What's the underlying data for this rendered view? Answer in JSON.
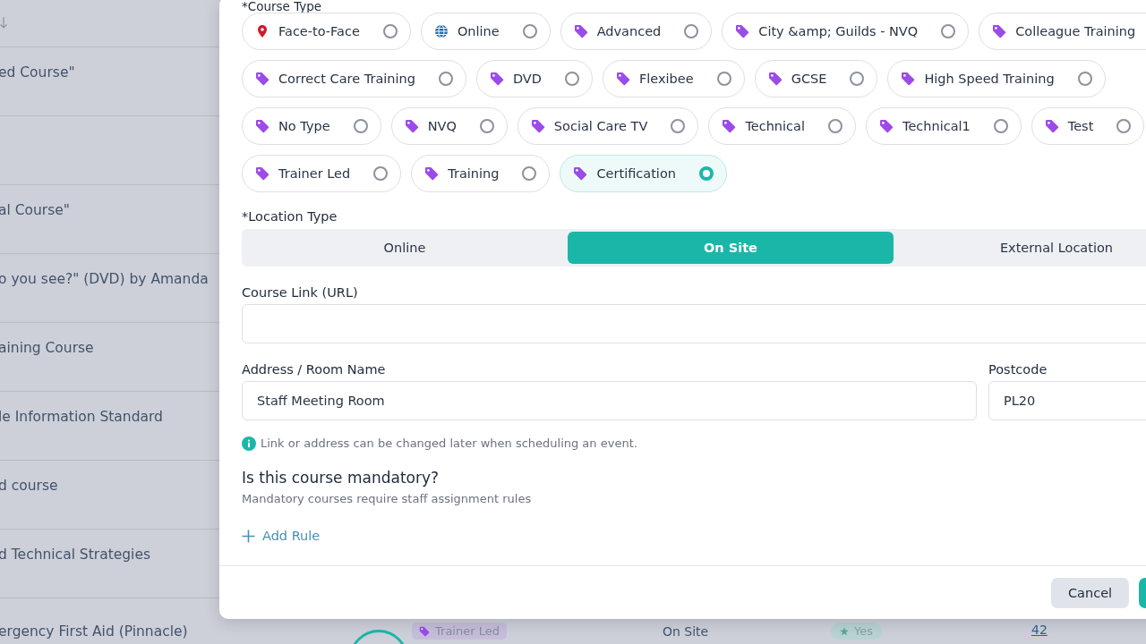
{
  "background_list": {
    "rows": [
      {
        "title": "ed Course\""
      },
      {},
      {
        "title": "al Course\""
      },
      {
        "title": "o you see?\" (DVD) by Amanda"
      },
      {
        "title": "aining Course"
      },
      {
        "title": "le Information Standard"
      },
      {
        "title": "d course"
      },
      {
        "title": "d Technical Strategies"
      },
      {
        "title": "ergency First Aid (Pinnacle)",
        "type_tag": "Trainer Led",
        "location": "On Site",
        "mandatory": "Yes",
        "count": "42"
      }
    ]
  },
  "modal": {
    "course_type": {
      "label": "*Course Type",
      "options": [
        {
          "label": "Face-to-Face",
          "kind": "pin",
          "selected": false
        },
        {
          "label": "Online",
          "kind": "globe",
          "selected": false
        },
        {
          "label": "Advanced",
          "kind": "tag",
          "selected": false
        },
        {
          "label": "City &amp; Guilds - NVQ",
          "kind": "tag",
          "selected": false
        },
        {
          "label": "Colleague Training",
          "kind": "tag",
          "selected": false
        },
        {
          "label": "Correct Care Training",
          "kind": "tag",
          "selected": false
        },
        {
          "label": "DVD",
          "kind": "tag",
          "selected": false
        },
        {
          "label": "Flexibee",
          "kind": "tag",
          "selected": false
        },
        {
          "label": "GCSE",
          "kind": "tag",
          "selected": false
        },
        {
          "label": "High Speed Training",
          "kind": "tag",
          "selected": false
        },
        {
          "label": "No Type",
          "kind": "tag",
          "selected": false
        },
        {
          "label": "NVQ",
          "kind": "tag",
          "selected": false
        },
        {
          "label": "Social Care TV",
          "kind": "tag",
          "selected": false
        },
        {
          "label": "Technical",
          "kind": "tag",
          "selected": false
        },
        {
          "label": "Technical1",
          "kind": "tag",
          "selected": false
        },
        {
          "label": "Test",
          "kind": "tag",
          "selected": false
        },
        {
          "label": "Trainer Led",
          "kind": "tag",
          "selected": false
        },
        {
          "label": "Training",
          "kind": "tag",
          "selected": false
        },
        {
          "label": "Certification",
          "kind": "tag",
          "selected": true
        }
      ]
    },
    "location_type": {
      "label": "*Location Type",
      "options": [
        {
          "label": "Online",
          "selected": false
        },
        {
          "label": "On Site",
          "selected": true
        },
        {
          "label": "External Location",
          "selected": false
        }
      ]
    },
    "course_link": {
      "label": "Course Link (URL)"
    },
    "address": {
      "label": "Address / Room Name",
      "value": "Staff Meeting Room"
    },
    "postcode": {
      "label": "Postcode",
      "value": "PL20"
    },
    "note": "Link or address can be changed later when scheduling an event.",
    "mandatory": {
      "title": "Is this course mandatory?",
      "subtitle": "Mandatory courses require staff assignment rules",
      "add_rule": "Add Rule"
    },
    "footer": {
      "cancel": "Cancel"
    }
  }
}
